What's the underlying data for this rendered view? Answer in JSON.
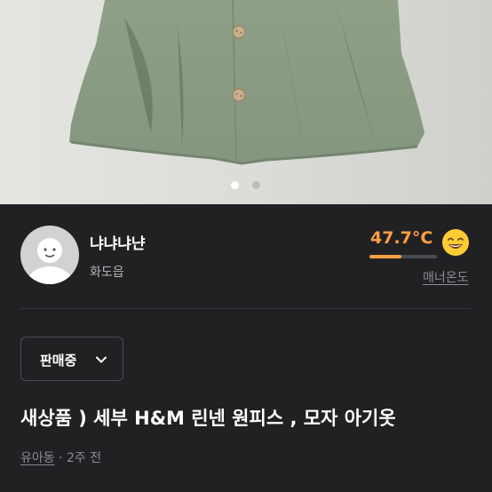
{
  "photo": {
    "slide_count": 2,
    "active_slide": 1,
    "accent_color": "#8a9a80"
  },
  "seller": {
    "nickname": "냐냐냐냔",
    "region": "화도읍",
    "avatar_icon": "default-avatar-icon",
    "manner_temp": "47.7°C",
    "manner_temp_value": 47.7,
    "manner_temp_fraction": 0.477,
    "manner_label": "매너온도",
    "manner_face_icon": "smiling-face-icon",
    "temp_color": "#ff9f43"
  },
  "status": {
    "label": "판매중",
    "icon": "chevron-down-icon"
  },
  "post": {
    "title": "새상품 ) 세부 H&M 린넨 원피스 , 모자 아기옷",
    "category": "유아동",
    "separator": "·",
    "time": "2주 전"
  }
}
